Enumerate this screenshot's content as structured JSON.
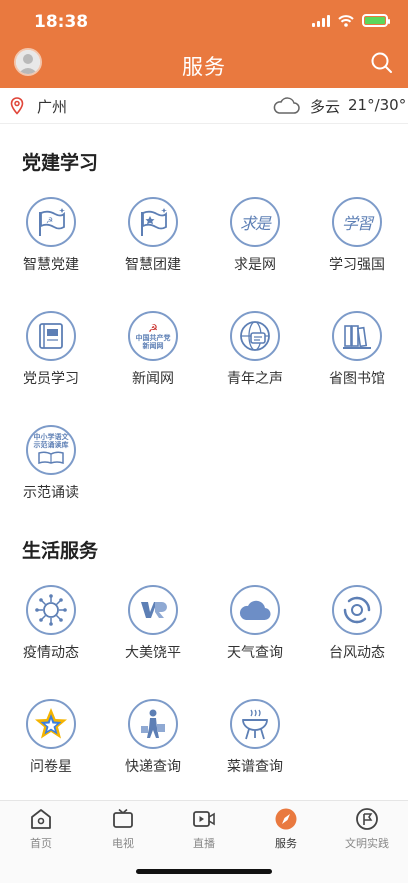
{
  "status_bar": {
    "time": "18:38"
  },
  "header": {
    "title": "服务"
  },
  "location": {
    "city": "广州",
    "weather": "多云",
    "temperature": "21°/30°"
  },
  "sections": [
    {
      "title": "党建学习",
      "items": [
        {
          "label": "智慧党建"
        },
        {
          "label": "智慧团建"
        },
        {
          "label": "求是网",
          "icon_text": "求是"
        },
        {
          "label": "学习强国",
          "icon_text": "学習"
        },
        {
          "label": "党员学习"
        },
        {
          "label": "新闻网",
          "icon_text_1": "中国共产党",
          "icon_text_2": "新闻网"
        },
        {
          "label": "青年之声"
        },
        {
          "label": "省图书馆"
        },
        {
          "label": "示范诵读",
          "icon_text_1": "中小学语文",
          "icon_text_2": "示范诵读库"
        }
      ]
    },
    {
      "title": "生活服务",
      "items": [
        {
          "label": "疫情动态"
        },
        {
          "label": "大美饶平"
        },
        {
          "label": "天气查询"
        },
        {
          "label": "台风动态"
        },
        {
          "label": "问卷星"
        },
        {
          "label": "快递查询"
        },
        {
          "label": "菜谱查询"
        }
      ]
    }
  ],
  "tabs": [
    {
      "label": "首页"
    },
    {
      "label": "电视"
    },
    {
      "label": "直播"
    },
    {
      "label": "服务"
    },
    {
      "label": "文明实践"
    }
  ],
  "colors": {
    "accent": "#e9793f",
    "icon_blue": "#7d9bc9",
    "active_tab": "#e9793f"
  }
}
